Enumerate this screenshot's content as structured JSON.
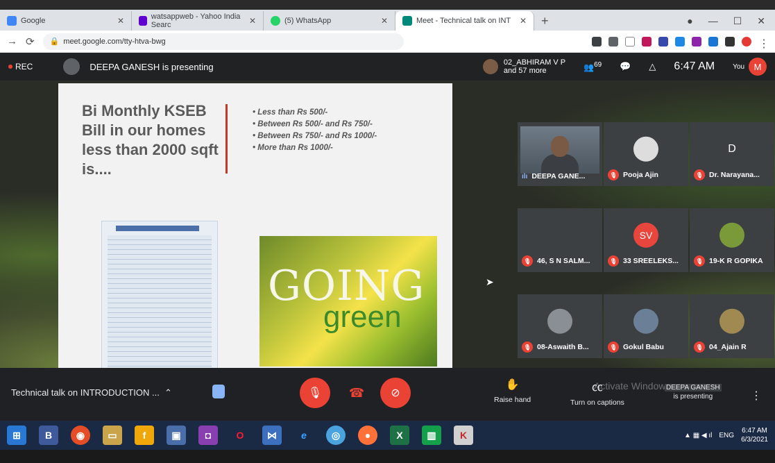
{
  "browser": {
    "tabs": [
      {
        "title": "Google",
        "icon": "google-icon"
      },
      {
        "title": "watsappweb - Yahoo India Searc",
        "icon": "yahoo-icon"
      },
      {
        "title": "(5) WhatsApp",
        "icon": "whatsapp-icon"
      },
      {
        "title": "Meet - Technical talk on INT",
        "icon": "meet-icon"
      }
    ],
    "url": "meet.google.com/tty-htva-bwg"
  },
  "meet": {
    "rec": "REC",
    "presenting_banner": "DEEPA GANESH is presenting",
    "others_line1": "02_ABHIRAM V P",
    "others_line2": "and 57 more",
    "participants_count": "69",
    "clock": "6:47 AM",
    "you_label": "You",
    "you_avatar": "M"
  },
  "slide": {
    "title": "Bi Monthly KSEB Bill in our homes less than 2000 sqft is....",
    "bullets": [
      "Less than Rs 500/-",
      "Between Rs 500/- and Rs 750/-",
      "Between Rs 750/- and Rs 1000/-",
      "More than Rs 1000/-"
    ],
    "image_line1": "GOING",
    "image_line2": "green"
  },
  "participants": [
    {
      "name": "DEEPA GANE...",
      "avatar": ""
    },
    {
      "name": "Pooja Ajin",
      "avatar": ""
    },
    {
      "name": "Dr. Narayana...",
      "avatar": "D"
    },
    {
      "name": "46, S N SALM...",
      "avatar": ""
    },
    {
      "name": "33 SREELEKS...",
      "avatar": "SV"
    },
    {
      "name": "19-K R GOPIKA",
      "avatar": ""
    },
    {
      "name": "08-Aswaith B...",
      "avatar": ""
    },
    {
      "name": "Gokul Babu",
      "avatar": ""
    },
    {
      "name": "04_Ajain R",
      "avatar": ""
    }
  ],
  "bottom": {
    "meeting_title": "Technical talk on INTRODUCTION ...",
    "raise_hand": "Raise hand",
    "captions": "Turn on captions",
    "presenter_name": "DEEPA GANESH",
    "presenting": "is presenting",
    "watermark": "Activate Windows"
  },
  "taskbar": {
    "lang": "ENG",
    "time": "6:47 AM",
    "date": "6/3/2021"
  }
}
